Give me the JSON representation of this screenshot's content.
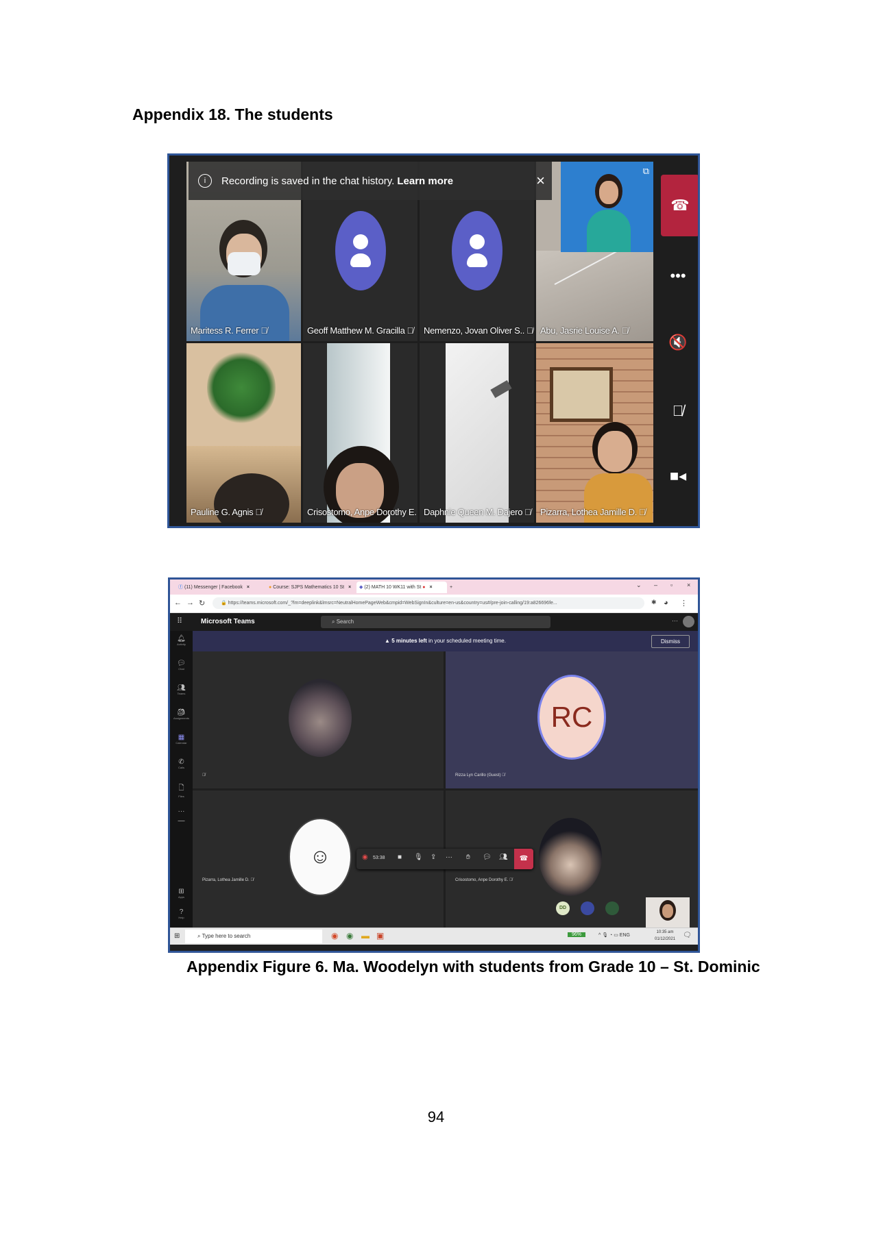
{
  "heading": "Appendix 18. The students",
  "caption": "Appendix Figure 6. Ma. Woodelyn with students from Grade 10 – St. Dominic",
  "page_number": "94",
  "screenshot1": {
    "banner_text": "Recording is saved in the chat history.",
    "banner_link": "Learn more",
    "participants": [
      "Maritess R. Ferrer",
      "Geoff Matthew M. Gracilla",
      "Nemenzo, Jovan Oliver S..",
      "Abu, Jasrie Louise A.",
      "Pauline G. Agnis",
      "Crisostomo, Anpe Dorothy E.",
      "Daphnie Queen M. Dajero",
      "Pizarra, Lothea Jamille D."
    ]
  },
  "screenshot2": {
    "tabs": [
      "(11) Messenger | Facebook",
      "Course: SJPS Mathematics 10 St",
      "(2) MATH 10 WK11 with St"
    ],
    "url": "https://teams.microsoft.com/_?lm=deeplink&lmsrc=NeutralHomePageWeb&cmpid=WebSignIn&culture=en-us&country=us#/pre-join-calling/19:a826696fe...",
    "app_name": "Microsoft Teams",
    "search_placeholder": "Search",
    "sidebar": [
      "Activity",
      "Chat",
      "Teams",
      "Assignments",
      "Calendar",
      "Calls",
      "Files",
      "Apps",
      "Help"
    ],
    "meeting_notice_bold": "5 minutes left",
    "meeting_notice": "in your scheduled meeting time.",
    "dismiss": "Dismiss",
    "tile_names": {
      "rizza": "Rizza Lyn Carillo (Guest)",
      "pizarra": "Pizarra, Lothea Jamille D.",
      "crisostomo": "Crisostomo, Anpe Dorothy E."
    },
    "rc_initials": "RC",
    "dd_initials": "DD",
    "timer": "53:38",
    "taskbar_search": "Type here to search",
    "battery": "96%",
    "lang": "ENG",
    "time": "10:35 am",
    "date": "01/12/2021"
  }
}
